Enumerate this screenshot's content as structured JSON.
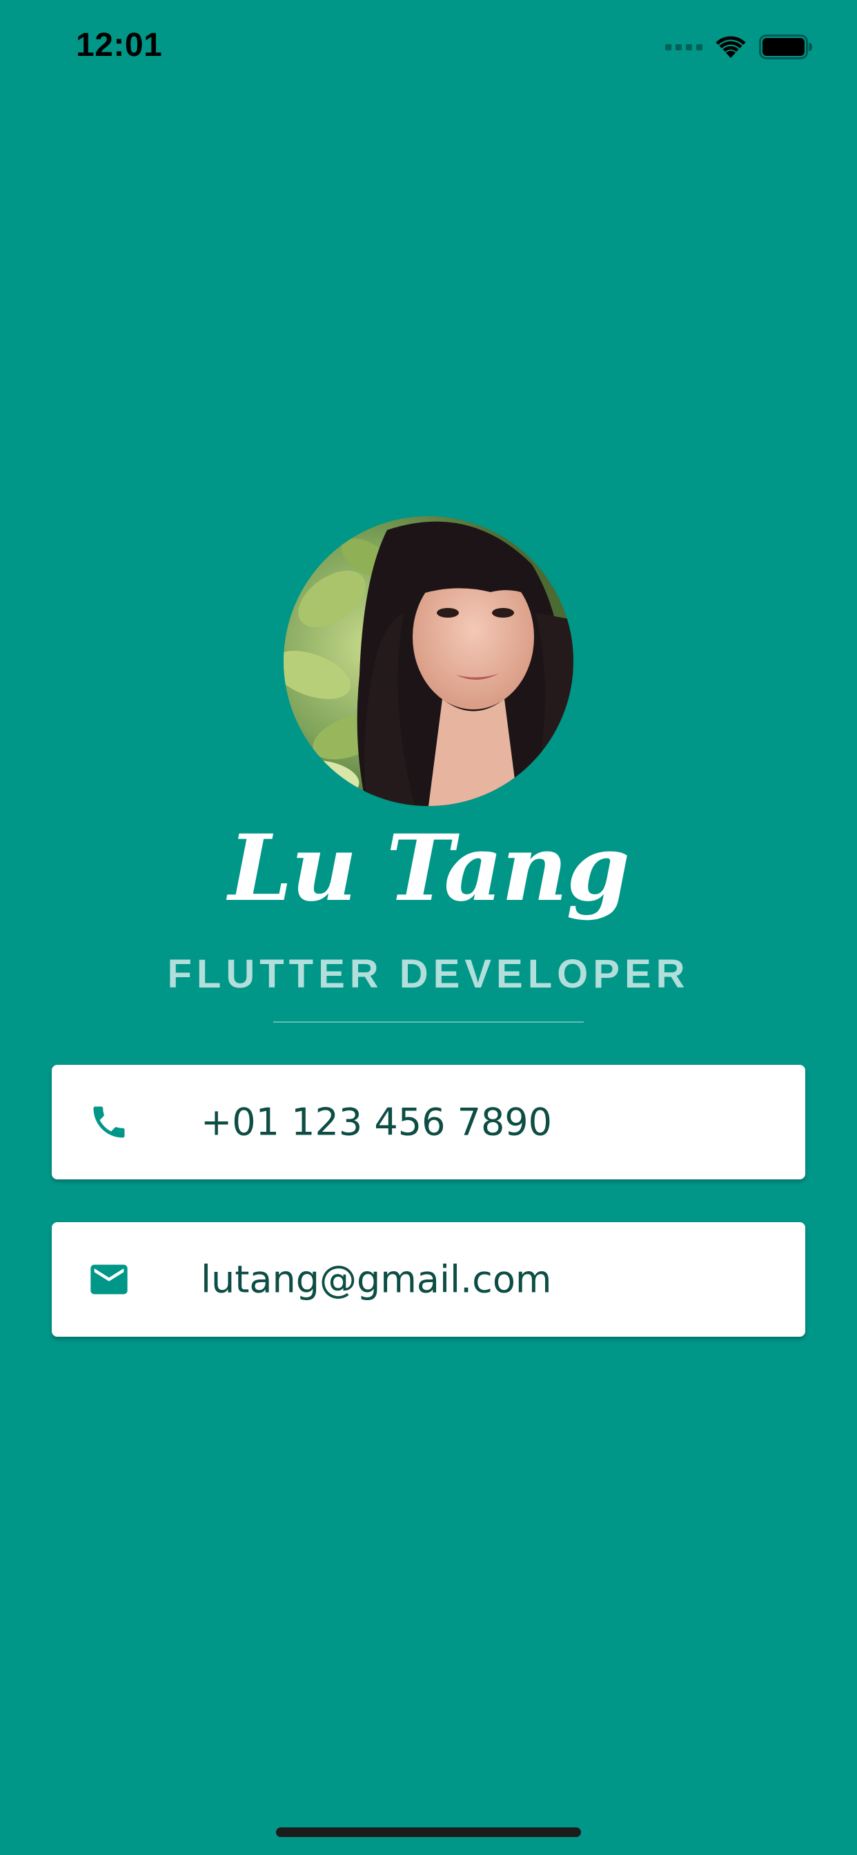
{
  "status_bar": {
    "time": "12:01",
    "signal_icon": "cellular-signal-icon",
    "wifi_icon": "wifi-icon",
    "battery_icon": "battery-icon"
  },
  "profile": {
    "avatar_icon": "profile-photo",
    "name": "Lu Tang",
    "title": "FLUTTER DEVELOPER"
  },
  "contacts": {
    "phone": {
      "icon": "phone-icon",
      "value": "+01 123 456 7890"
    },
    "email": {
      "icon": "mail-icon",
      "value": "lutang@gmail.com"
    }
  },
  "colors": {
    "background": "#009688",
    "title": "#b2dfdb",
    "card_background": "#ffffff",
    "card_text": "#0d4d44",
    "icon": "#009688"
  }
}
